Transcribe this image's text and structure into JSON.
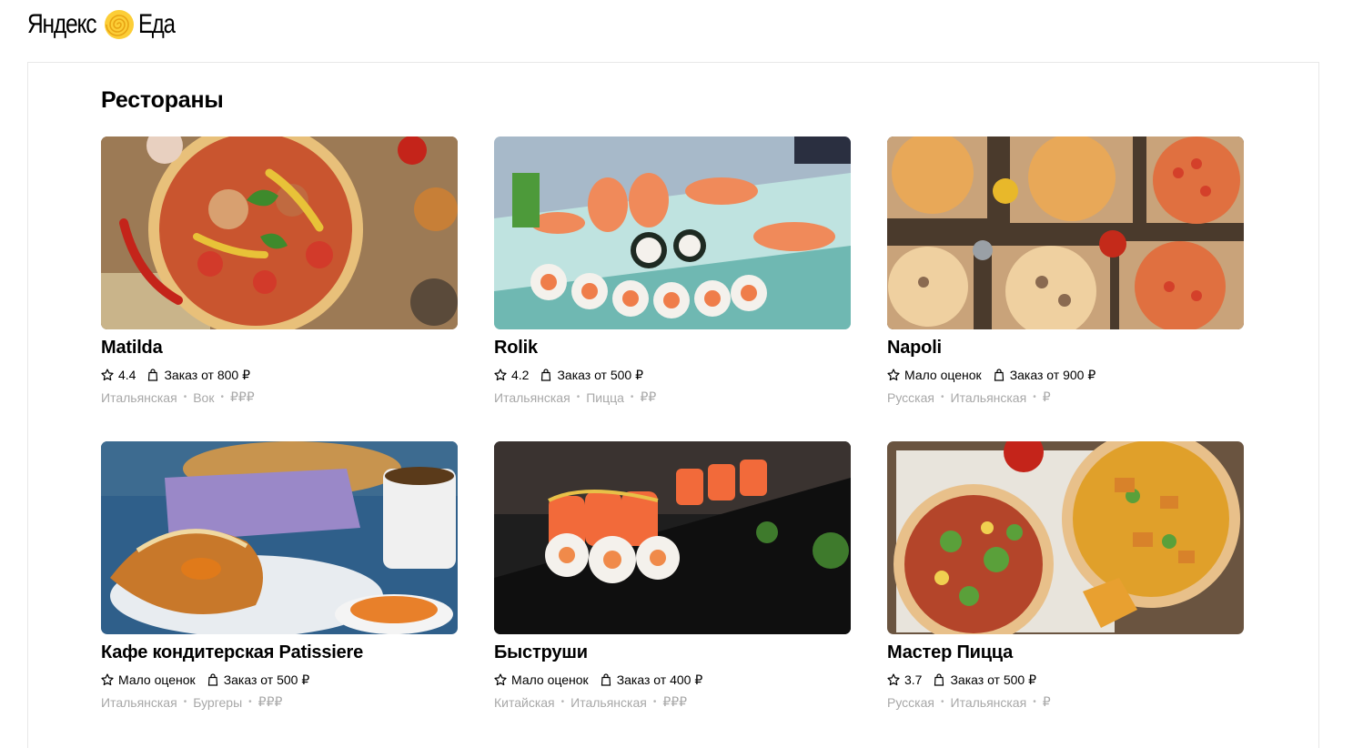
{
  "header": {
    "logo_word1": "Яндекс",
    "logo_word2": "Еда",
    "logo_icon": "spiral-logo-icon",
    "logo_color": "#fcce37"
  },
  "page_title": "Рестораны",
  "restaurants": [
    {
      "name": "Matilda",
      "rating": "4.4",
      "min_order": "Заказ от 800 ₽",
      "cuisine1": "Итальянская",
      "cuisine2": "Вок",
      "price": "₽₽₽",
      "image": "pizza-photo"
    },
    {
      "name": "Rolik",
      "rating": "4.2",
      "min_order": "Заказ от 500 ₽",
      "cuisine1": "Итальянская",
      "cuisine2": "Пицца",
      "price": "₽₽",
      "image": "sushi-platter-photo"
    },
    {
      "name": "Napoli",
      "rating": "Мало оценок",
      "min_order": "Заказ от 900 ₽",
      "cuisine1": "Русская",
      "cuisine2": "Итальянская",
      "price": "₽",
      "image": "pizzas-in-boxes-photo"
    },
    {
      "name": "Кафе кондитерская Patissiere",
      "rating": "Мало оценок",
      "min_order": "Заказ от 500 ₽",
      "cuisine1": "Итальянская",
      "cuisine2": "Бургеры",
      "price": "₽₽₽",
      "image": "pastries-photo"
    },
    {
      "name": "Быструши",
      "rating": "Мало оценок",
      "min_order": "Заказ от 400 ₽",
      "cuisine1": "Китайская",
      "cuisine2": "Итальянская",
      "price": "₽₽₽",
      "image": "sushi-rolls-photo"
    },
    {
      "name": "Мастер Пицца",
      "rating": "3.7",
      "min_order": "Заказ от 500 ₽",
      "cuisine1": "Русская",
      "cuisine2": "Итальянская",
      "price": "₽",
      "image": "two-pizzas-photo"
    }
  ],
  "icons": {
    "rating": "star-icon",
    "order": "shopping-bag-icon"
  }
}
